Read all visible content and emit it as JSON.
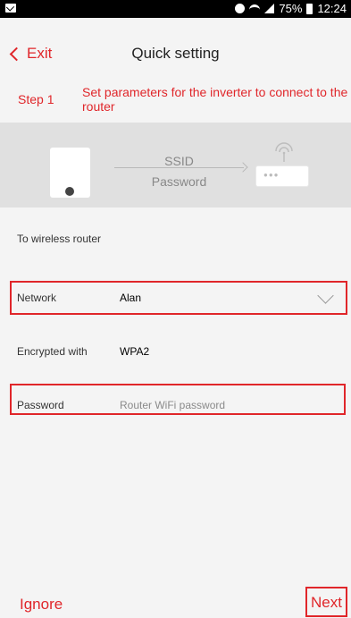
{
  "status_bar": {
    "battery": "75%",
    "time": "12:24"
  },
  "header": {
    "back_label": "Exit",
    "title": "Quick setting"
  },
  "step": {
    "label": "Step 1",
    "description": "Set parameters for the inverter to connect to the router"
  },
  "diagram": {
    "ssid_label": "SSID",
    "password_label": "Password"
  },
  "section_title": "To wireless router",
  "form": {
    "network": {
      "label": "Network",
      "value": "Alan"
    },
    "encryption": {
      "label": "Encrypted with",
      "value": "WPA2"
    },
    "password": {
      "label": "Password",
      "placeholder": "Router WiFi password"
    }
  },
  "footer": {
    "ignore_label": "Ignore",
    "next_label": "Next"
  },
  "colors": {
    "accent": "#e0262a",
    "background": "#f4f4f4",
    "diagram_bg": "#e0e0e0"
  }
}
